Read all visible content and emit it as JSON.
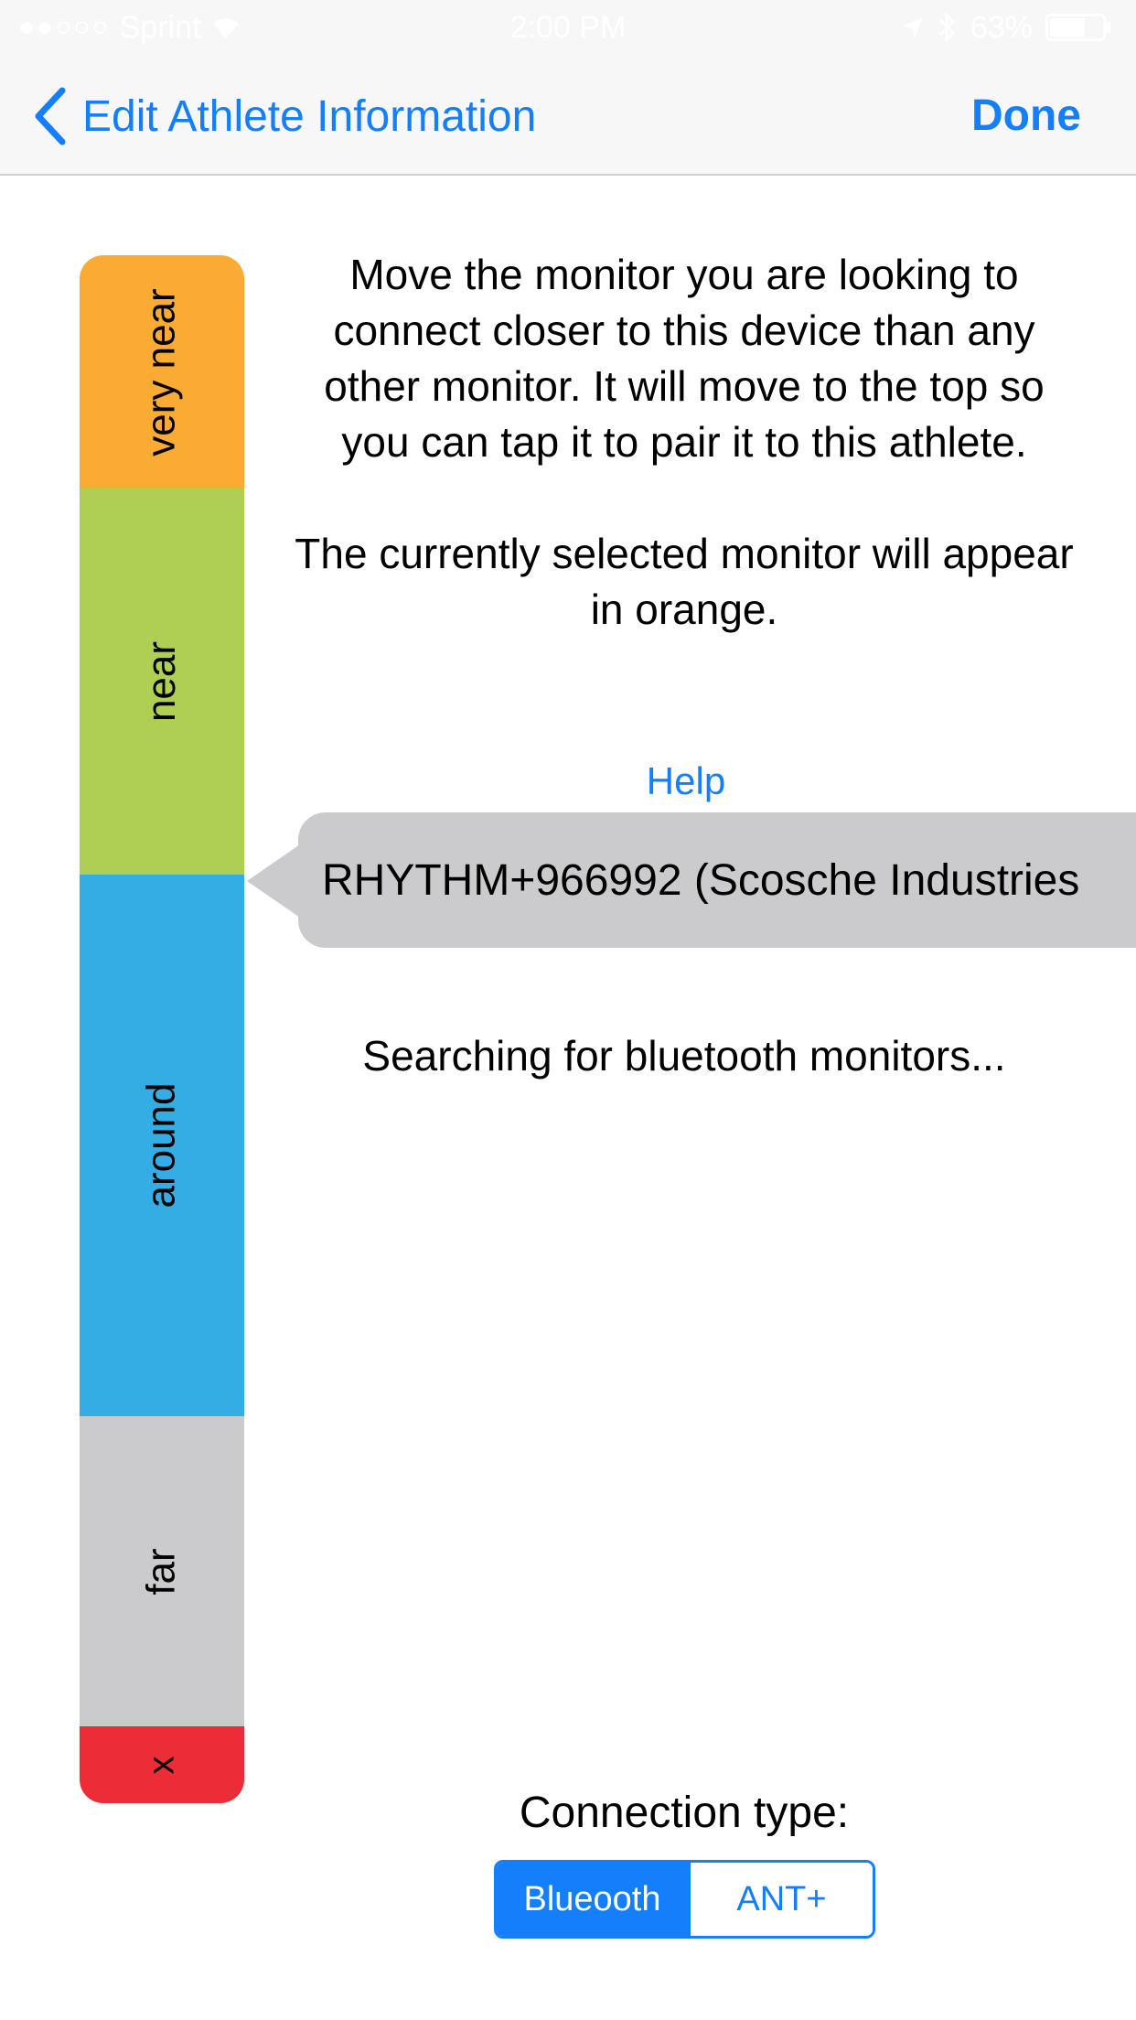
{
  "status_bar": {
    "signal": "●●○○○",
    "carrier": "Sprint",
    "time": "2:00 PM",
    "battery": "63%"
  },
  "nav": {
    "back_label": "Edit Athlete Information",
    "done_label": "Done"
  },
  "proximity": {
    "zones": [
      "very near",
      "near",
      "around",
      "far",
      "x"
    ]
  },
  "instructions": {
    "paragraph1": "Move the monitor you are looking to connect closer to this device than any other monitor. It will move to the top so you can tap it to pair it to this athlete.",
    "paragraph2": "The currently selected monitor will appear in orange."
  },
  "help_label": "Help",
  "monitor": {
    "label": "RHYTHM+966992 (Scosche Industries"
  },
  "searching_label": "Searching for bluetooth monitors...",
  "connection": {
    "label": "Connection type:",
    "options": [
      "Blueooth",
      "ANT+"
    ],
    "selected": "Blueooth"
  },
  "colors": {
    "accent": "#147efb",
    "very_near": "#f9ab34",
    "near": "#aecf53",
    "around": "#34ade4",
    "far": "#cbcacc",
    "x": "#ec2d38"
  }
}
